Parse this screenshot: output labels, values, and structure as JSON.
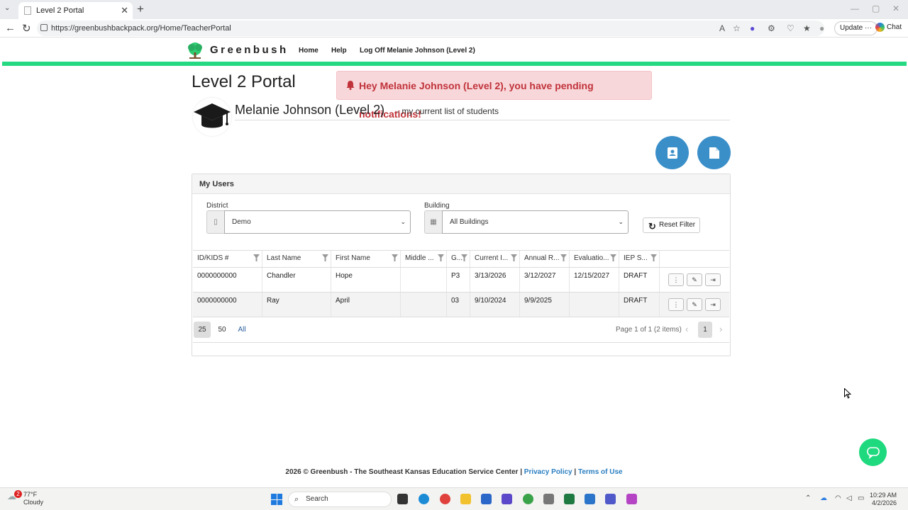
{
  "browser": {
    "tab_title": "Level 2 Portal",
    "url": "https://greenbushbackpack.org/Home/TeacherPortal",
    "update_label": "Update",
    "chat_label": "Chat"
  },
  "site": {
    "brand": "Greenbush",
    "nav": [
      "Home",
      "Help",
      "Log Off Melanie Johnson (Level 2)"
    ]
  },
  "portal": {
    "title": "Level 2 Portal",
    "notification": "Hey Melanie Johnson (Level 2), you have pending notifications!",
    "user_name": "Melanie Johnson (Level 2)",
    "user_subtitle": "- my current list of students"
  },
  "panel": {
    "title": "My Users",
    "district_label": "District",
    "district_value": "Demo",
    "building_label": "Building",
    "building_value": "All Buildings",
    "reset_label": "Reset Filter"
  },
  "grid": {
    "columns": [
      "ID/KIDS #",
      "Last Name",
      "First Name",
      "Middle ...",
      "G...",
      "Current I...",
      "Annual R...",
      "Evaluatio...",
      "IEP S...",
      ""
    ],
    "rows": [
      [
        "0000000000",
        "Chandler",
        "Hope",
        "",
        "P3",
        "3/13/2026",
        "3/12/2027",
        "12/15/2027",
        "DRAFT"
      ],
      [
        "0000000000",
        "Ray",
        "April",
        "",
        "03",
        "9/10/2024",
        "9/9/2025",
        "",
        "DRAFT"
      ]
    ]
  },
  "pager": {
    "sizes": [
      "25",
      "50",
      "All"
    ],
    "info": "Page 1 of 1 (2 items)",
    "current": "1"
  },
  "footer": {
    "text": "2026 © Greenbush - The Southeast Kansas Education Service Center |",
    "privacy": "Privacy Policy",
    "sep": "|",
    "terms": "Terms of Use"
  },
  "taskbar": {
    "weather_temp": "77°F",
    "weather_desc": "Cloudy",
    "badge": "2",
    "search": "Search",
    "time": "10:29 AM",
    "date": "4/2/2026"
  },
  "colors": {
    "accent_green": "#24d982",
    "button_blue": "#3b8fc9",
    "alert_bg": "#f8d7da",
    "alert_text": "#c0333a"
  }
}
